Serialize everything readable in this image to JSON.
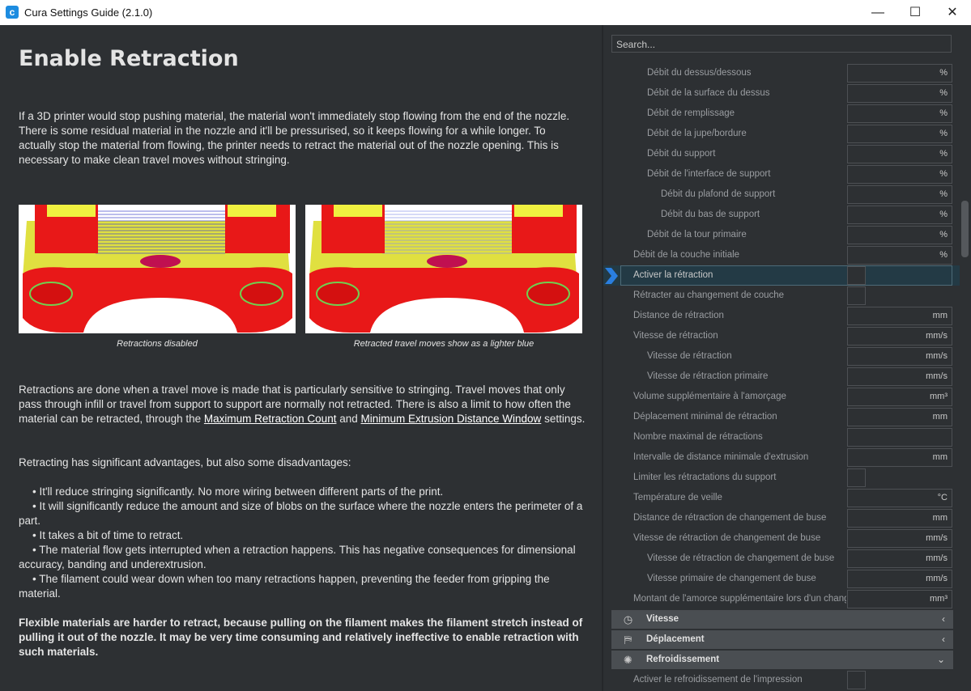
{
  "window": {
    "title": "Cura Settings Guide (2.1.0)",
    "minimize_glyph": "—",
    "maximize_glyph": "☐",
    "close_glyph": "✕"
  },
  "article": {
    "heading": "Enable Retraction",
    "intro": "If a 3D printer would stop pushing material, the material won't immediately stop flowing from the end of the nozzle. There is some residual material in the nozzle and it'll be pressurised, so it keeps flowing for a while longer. To actually stop the material from flowing, the printer needs to retract the material out of the nozzle opening. This is necessary to make clean travel moves without stringing.",
    "captions": [
      "Retractions disabled",
      "Retracted travel moves show as a lighter blue"
    ],
    "para2_start": "Retractions are done when a travel move is made that is particularly sensitive to stringing. Travel moves that only pass through infill or travel from support to support are normally not retracted. There is also a limit to how often the material can be retracted, through the ",
    "link1": "Maximum Retraction Count",
    "para2_mid": " and ",
    "link2": "Minimum Extrusion Distance Window",
    "para2_end": " settings.",
    "para3": "Retracting has significant advantages, but also some disadvantages:",
    "bullets": [
      "• It'll reduce stringing significantly. No more wiring between different parts of the print.",
      "• It will significantly reduce the amount and size of blobs on the surface where the nozzle enters the perimeter of a part.",
      "• It takes a bit of time to retract.",
      "• The material flow gets interrupted when a retraction happens. This has negative consequences for dimensional accuracy, banding and underextrusion.",
      "• The filament could wear down when too many retractions happen, preventing the feeder from gripping the material."
    ],
    "para4": "Flexible materials are harder to retract, because pulling on the filament makes the filament stretch instead of pulling it out of the nozzle. It may be very time consuming and relatively ineffective to enable retraction with such materials."
  },
  "panel": {
    "search_placeholder": "Search...",
    "settings": [
      {
        "label": "Débit du dessus/dessous",
        "unit": "%",
        "indent": 2,
        "type": "field"
      },
      {
        "label": "Débit de la surface du dessus",
        "unit": "%",
        "indent": 2,
        "type": "field"
      },
      {
        "label": "Débit de remplissage",
        "unit": "%",
        "indent": 2,
        "type": "field"
      },
      {
        "label": "Débit de la jupe/bordure",
        "unit": "%",
        "indent": 2,
        "type": "field"
      },
      {
        "label": "Débit du support",
        "unit": "%",
        "indent": 2,
        "type": "field"
      },
      {
        "label": "Débit de l'interface de support",
        "unit": "%",
        "indent": 2,
        "type": "field"
      },
      {
        "label": "Débit du plafond de support",
        "unit": "%",
        "indent": 3,
        "type": "field"
      },
      {
        "label": "Débit du bas de support",
        "unit": "%",
        "indent": 3,
        "type": "field"
      },
      {
        "label": "Débit de la tour primaire",
        "unit": "%",
        "indent": 2,
        "type": "field"
      },
      {
        "label": "Débit de la couche initiale",
        "unit": "%",
        "indent": 1,
        "type": "field"
      },
      {
        "label": "Activer la rétraction",
        "unit": "",
        "indent": 1,
        "type": "check",
        "active": true
      },
      {
        "label": "Rétracter au changement de couche",
        "unit": "",
        "indent": 1,
        "type": "check"
      },
      {
        "label": "Distance de rétraction",
        "unit": "mm",
        "indent": 1,
        "type": "field"
      },
      {
        "label": "Vitesse de rétraction",
        "unit": "mm/s",
        "indent": 1,
        "type": "field"
      },
      {
        "label": "Vitesse de rétraction",
        "unit": "mm/s",
        "indent": 2,
        "type": "field"
      },
      {
        "label": "Vitesse de rétraction primaire",
        "unit": "mm/s",
        "indent": 2,
        "type": "field"
      },
      {
        "label": "Volume supplémentaire à l'amorçage",
        "unit": "mm³",
        "indent": 1,
        "type": "field"
      },
      {
        "label": "Déplacement minimal de rétraction",
        "unit": "mm",
        "indent": 1,
        "type": "field"
      },
      {
        "label": "Nombre maximal de rétractions",
        "unit": "",
        "indent": 1,
        "type": "field"
      },
      {
        "label": "Intervalle de distance minimale d'extrusion",
        "unit": "mm",
        "indent": 1,
        "type": "field"
      },
      {
        "label": "Limiter les rétractations du support",
        "unit": "",
        "indent": 1,
        "type": "check"
      },
      {
        "label": "Température de veille",
        "unit": "°C",
        "indent": 1,
        "type": "field"
      },
      {
        "label": "Distance de rétraction de changement de buse",
        "unit": "mm",
        "indent": 1,
        "type": "field"
      },
      {
        "label": "Vitesse de rétraction de changement de buse",
        "unit": "mm/s",
        "indent": 1,
        "type": "field"
      },
      {
        "label": "Vitesse de rétraction de changement de buse",
        "unit": "mm/s",
        "indent": 2,
        "type": "field"
      },
      {
        "label": "Vitesse primaire de changement de buse",
        "unit": "mm/s",
        "indent": 2,
        "type": "field"
      },
      {
        "label": "Montant de l'amorce supplémentaire lors d'un changement de buse",
        "unit": "mm³",
        "indent": 1,
        "type": "field"
      }
    ],
    "categories": [
      {
        "label": "Vitesse",
        "icon": "speed-gauge-icon",
        "glyph": "◷",
        "chevron": "‹"
      },
      {
        "label": "Déplacement",
        "icon": "travel-icon",
        "glyph": "⛿",
        "chevron": "‹"
      },
      {
        "label": "Refroidissement",
        "icon": "fan-icon",
        "glyph": "✺",
        "chevron": "⌄"
      }
    ],
    "after_category": {
      "label": "Activer le refroidissement de l'impression",
      "type": "check"
    }
  },
  "colors": {
    "background": "#2d3033",
    "active_row": "#233a45",
    "marker": "#2a7ee0",
    "category_bar": "#4a4e52"
  }
}
